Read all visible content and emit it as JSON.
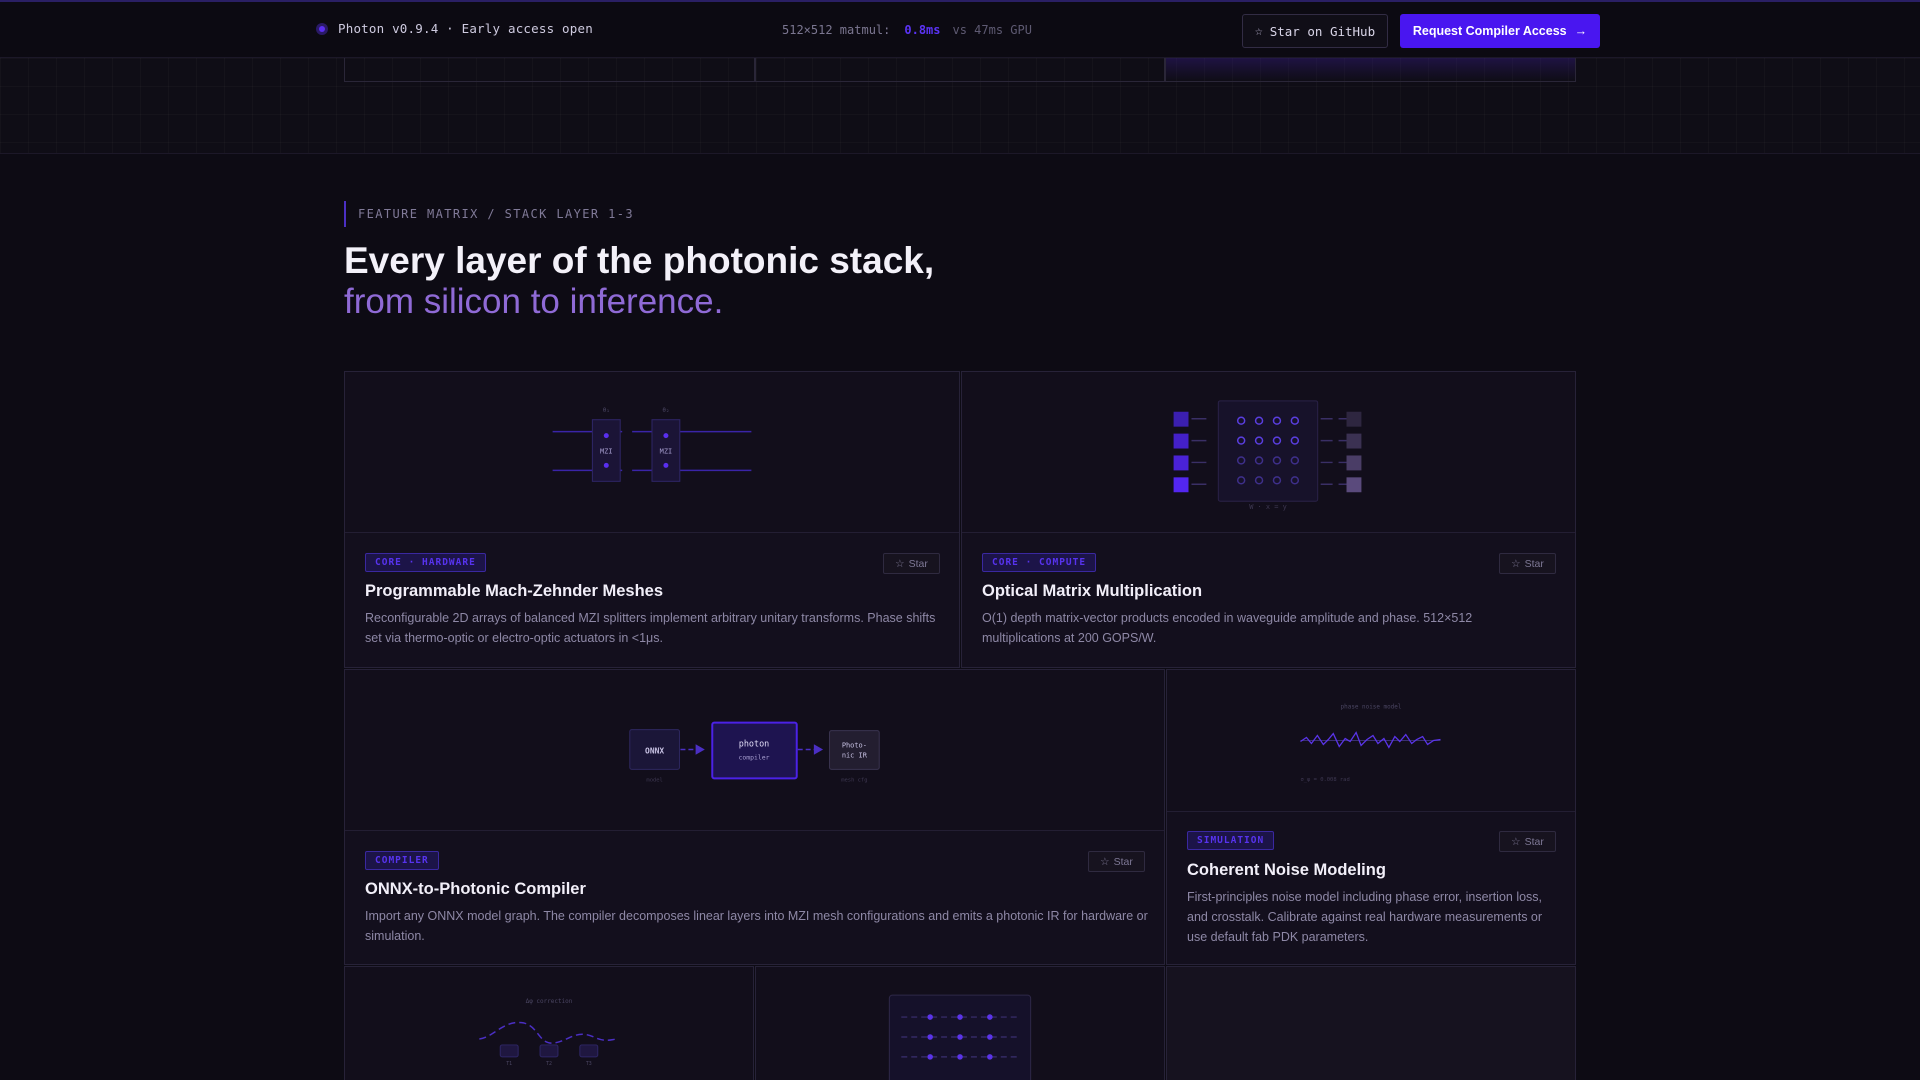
{
  "topbar": {
    "version_text": "Photon v0.9.4 · Early access open",
    "benchmark_label": "512×512 matmul:",
    "benchmark_value": "0.8ms",
    "benchmark_compare": "vs 47ms GPU",
    "github_icon": "star-icon",
    "github_label": "Star on GitHub",
    "request_label": "Request Compiler Access",
    "request_icon": "arrow-right-icon"
  },
  "section": {
    "eyebrow": "FEATURE MATRIX / STACK LAYER 1-3",
    "title_line1": "Every layer of the photonic stack,",
    "title_line2": "from silicon to inference."
  },
  "cards": [
    {
      "tag": "CORE · HARDWARE",
      "title": "Programmable Mach-Zehnder Meshes",
      "description": "Reconfigurable 2D arrays of balanced MZI splitters implement arbitrary unitary transforms. Phase shifts set via thermo-optic or electro-optic actuators in <1μs.",
      "star_label": "Star",
      "viz": {
        "mzi_label": "MZI",
        "phase_1": "θ₁",
        "phase_2": "θ₂"
      }
    },
    {
      "tag": "CORE · COMPUTE",
      "title": "Optical Matrix Multiplication",
      "description": "O(1) depth matrix-vector products encoded in waveguide amplitude and phase. 512×512 multiplications at 200 GOPS/W.",
      "star_label": "Star",
      "viz": {
        "caption": "W · x = y"
      }
    },
    {
      "tag": "COMPILER",
      "title": "ONNX-to-Photonic Compiler",
      "description": "Import any ONNX model graph. The compiler decomposes linear layers into MZI mesh configurations and emits a photonic IR for hardware or simulation.",
      "star_label": "Star",
      "viz": {
        "node1": "ONNX",
        "node1_sub": "model",
        "node2": "photon",
        "node2_sub": "compiler",
        "node3_a": "Photo-",
        "node3_b": "nic IR",
        "node3_sub": "mesh cfg"
      }
    },
    {
      "tag": "SIMULATION",
      "title": "Coherent Noise Modeling",
      "description": "First-principles noise model including phase error, insertion loss, and crosstalk. Calibrate against real hardware measurements or use default fab PDK parameters.",
      "star_label": "Star",
      "viz": {
        "caption": "phase noise model",
        "footnote": "σ_φ = 0.008 rad"
      }
    },
    {
      "viz": {
        "caption": "Δφ correction",
        "t1": "T1",
        "t2": "T2",
        "t3": "T3"
      }
    }
  ],
  "colors": {
    "accent": "#4916f0",
    "accent_text": "#5b33f5",
    "subtitle": "#8f6ad6",
    "background": "#0d0b14"
  }
}
